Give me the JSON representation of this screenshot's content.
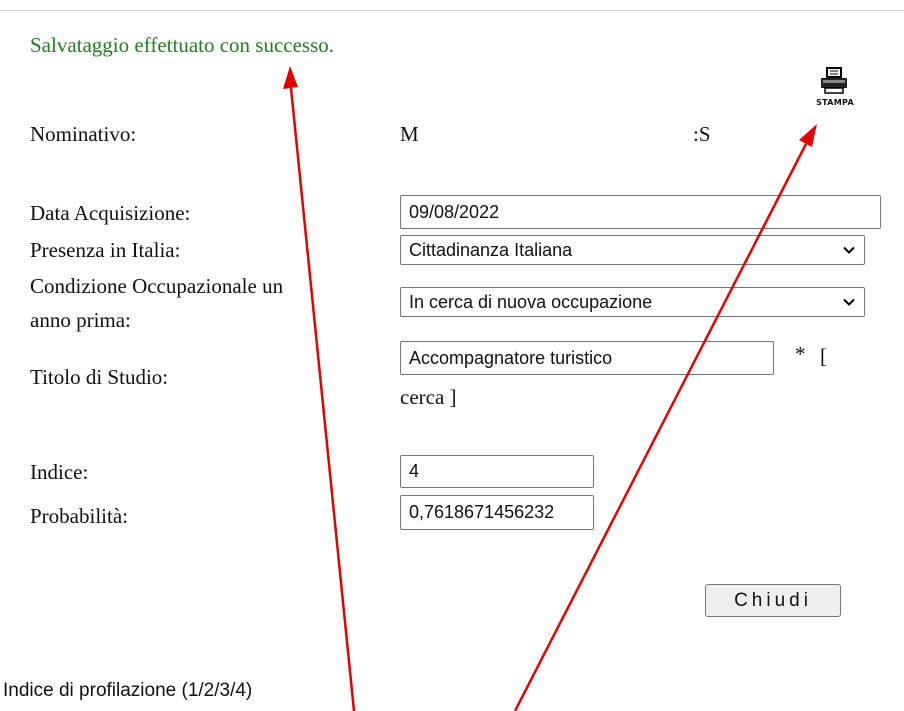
{
  "message": "Salvataggio effettuato con successo.",
  "print": {
    "label": "STAMPA",
    "icon": "printer-icon"
  },
  "form": {
    "nominativo_label": "Nominativo:",
    "nominativo_part1": "M",
    "nominativo_part2": ":S",
    "data_label": "Data Acquisizione:",
    "data_value": "09/08/2022",
    "presenza_label": "Presenza in Italia:",
    "presenza_value": "Cittadinanza Italiana",
    "condizione_label_line1": "Condizione Occupazionale un",
    "condizione_label_line2": "anno prima:",
    "condizione_value": "In cerca di nuova occupazione",
    "titolo_label": "Titolo di Studio:",
    "titolo_value": "Accompagnatore turistico",
    "titolo_required": "*",
    "titolo_search_open": "[",
    "titolo_search": "cerca ]",
    "indice_label": "Indice:",
    "indice_value": "4",
    "probabilita_label": "Probabilità:",
    "probabilita_value": "0,7618671456232"
  },
  "close_button": "Chiudi",
  "annotation": {
    "caption": "Indice di profilazione (1/2/3/4)",
    "arrow_color": "#e00000"
  }
}
